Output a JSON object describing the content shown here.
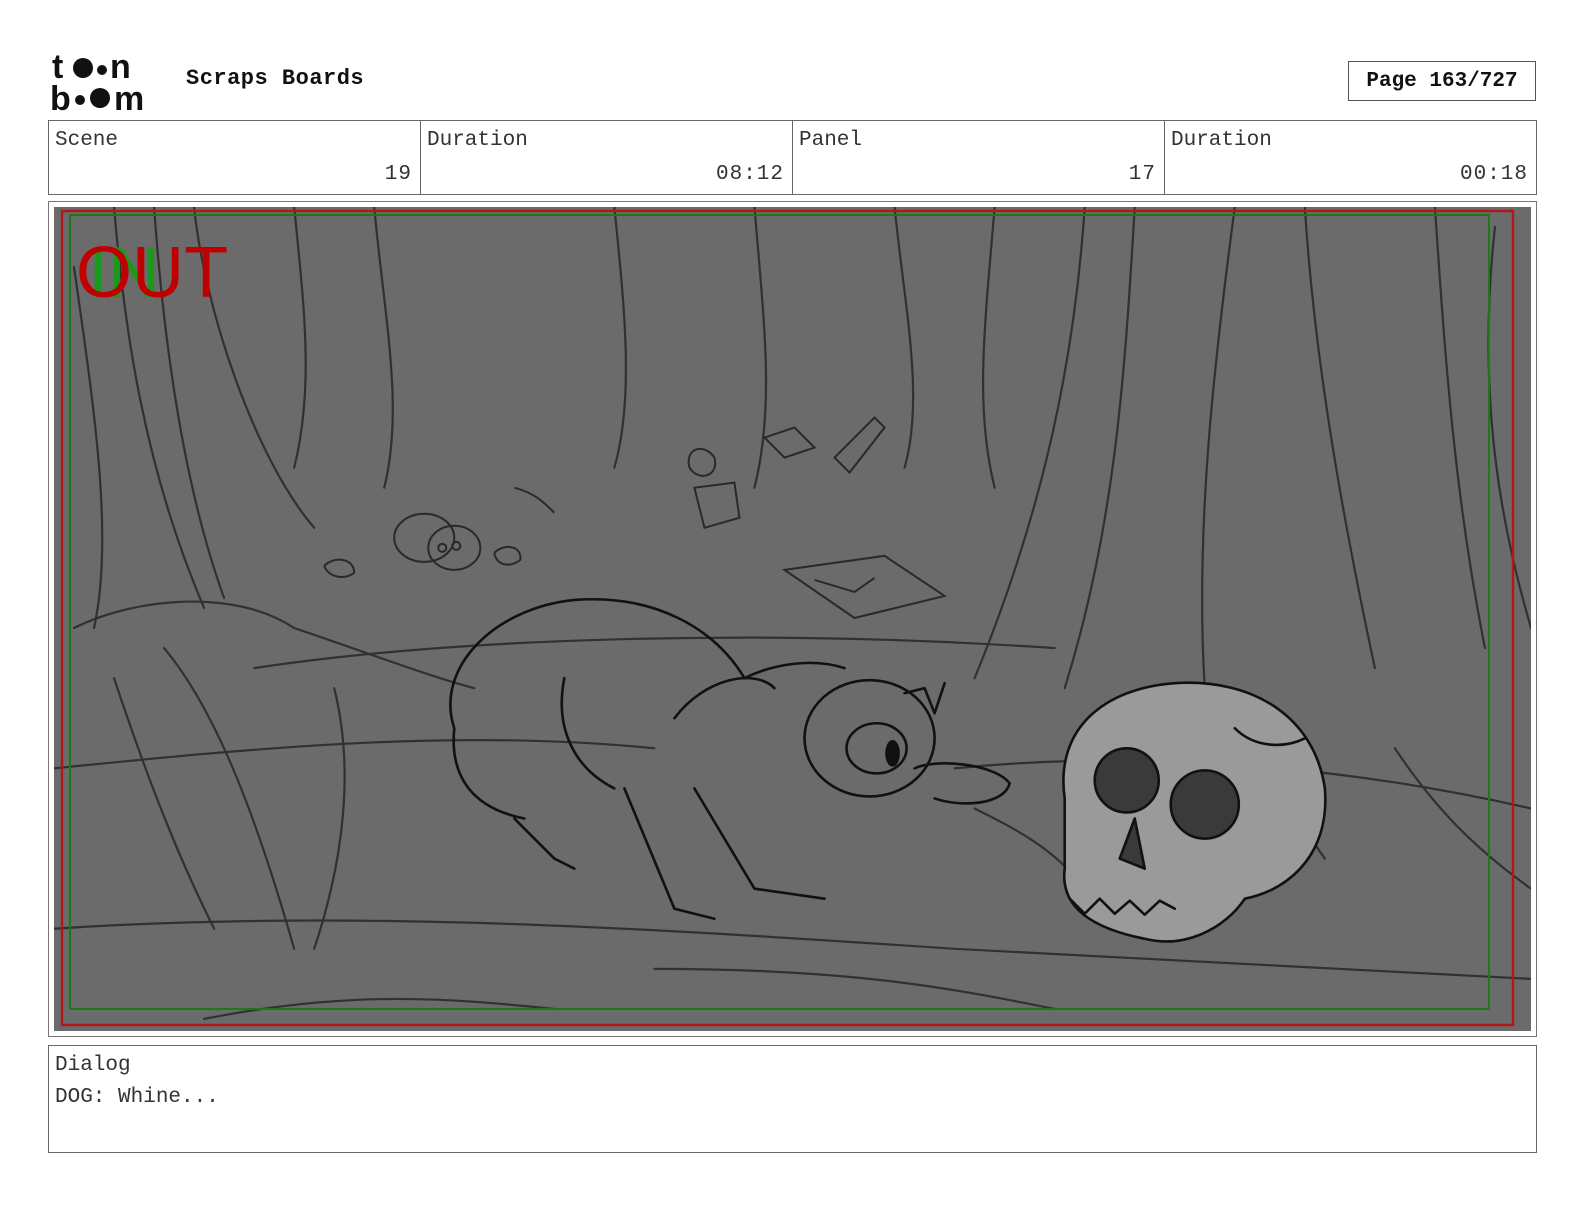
{
  "header": {
    "logo_text": "toon boom",
    "title": "Scraps Boards",
    "page_label": "Page 163/727"
  },
  "info": [
    {
      "label": "Scene",
      "value": "19"
    },
    {
      "label": "Duration",
      "value": "08:12"
    },
    {
      "label": "Panel",
      "value": "17"
    },
    {
      "label": "Duration",
      "value": "00:18"
    }
  ],
  "panel": {
    "overlay_out": "OUT",
    "overlay_in": "IN",
    "colors": {
      "background": "#6b6b6b",
      "sketch": "#1e1e1e",
      "out_text": "#c00000",
      "in_text": "#1a9a1a",
      "frame_red": "#b01818",
      "frame_green": "#1a7a1a",
      "skull_fill": "#9a9a9a"
    }
  },
  "dialog": {
    "label": "Dialog",
    "text": "DOG: Whine..."
  }
}
